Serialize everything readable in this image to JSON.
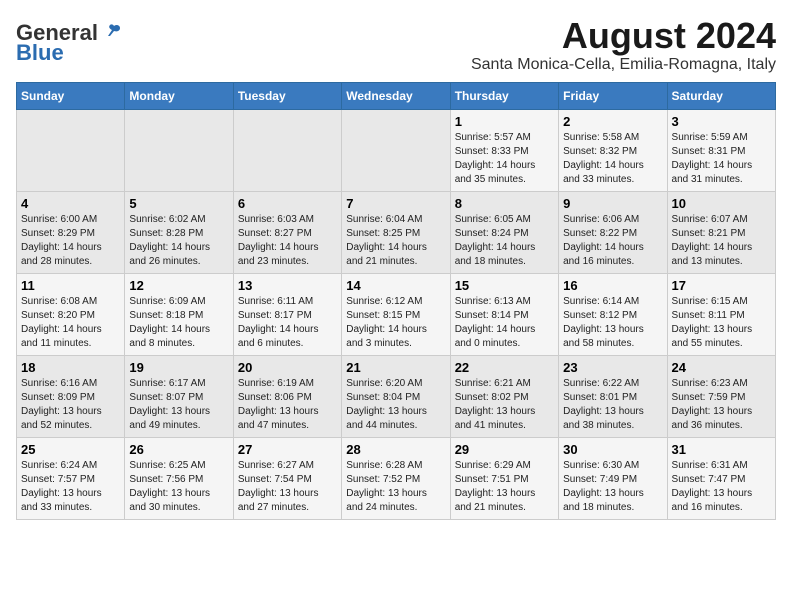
{
  "header": {
    "logo_general": "General",
    "logo_blue": "Blue",
    "title": "August 2024",
    "subtitle": "Santa Monica-Cella, Emilia-Romagna, Italy"
  },
  "days_of_week": [
    "Sunday",
    "Monday",
    "Tuesday",
    "Wednesday",
    "Thursday",
    "Friday",
    "Saturday"
  ],
  "weeks": [
    [
      {
        "num": "",
        "info": ""
      },
      {
        "num": "",
        "info": ""
      },
      {
        "num": "",
        "info": ""
      },
      {
        "num": "",
        "info": ""
      },
      {
        "num": "1",
        "info": "Sunrise: 5:57 AM\nSunset: 8:33 PM\nDaylight: 14 hours\nand 35 minutes."
      },
      {
        "num": "2",
        "info": "Sunrise: 5:58 AM\nSunset: 8:32 PM\nDaylight: 14 hours\nand 33 minutes."
      },
      {
        "num": "3",
        "info": "Sunrise: 5:59 AM\nSunset: 8:31 PM\nDaylight: 14 hours\nand 31 minutes."
      }
    ],
    [
      {
        "num": "4",
        "info": "Sunrise: 6:00 AM\nSunset: 8:29 PM\nDaylight: 14 hours\nand 28 minutes."
      },
      {
        "num": "5",
        "info": "Sunrise: 6:02 AM\nSunset: 8:28 PM\nDaylight: 14 hours\nand 26 minutes."
      },
      {
        "num": "6",
        "info": "Sunrise: 6:03 AM\nSunset: 8:27 PM\nDaylight: 14 hours\nand 23 minutes."
      },
      {
        "num": "7",
        "info": "Sunrise: 6:04 AM\nSunset: 8:25 PM\nDaylight: 14 hours\nand 21 minutes."
      },
      {
        "num": "8",
        "info": "Sunrise: 6:05 AM\nSunset: 8:24 PM\nDaylight: 14 hours\nand 18 minutes."
      },
      {
        "num": "9",
        "info": "Sunrise: 6:06 AM\nSunset: 8:22 PM\nDaylight: 14 hours\nand 16 minutes."
      },
      {
        "num": "10",
        "info": "Sunrise: 6:07 AM\nSunset: 8:21 PM\nDaylight: 14 hours\nand 13 minutes."
      }
    ],
    [
      {
        "num": "11",
        "info": "Sunrise: 6:08 AM\nSunset: 8:20 PM\nDaylight: 14 hours\nand 11 minutes."
      },
      {
        "num": "12",
        "info": "Sunrise: 6:09 AM\nSunset: 8:18 PM\nDaylight: 14 hours\nand 8 minutes."
      },
      {
        "num": "13",
        "info": "Sunrise: 6:11 AM\nSunset: 8:17 PM\nDaylight: 14 hours\nand 6 minutes."
      },
      {
        "num": "14",
        "info": "Sunrise: 6:12 AM\nSunset: 8:15 PM\nDaylight: 14 hours\nand 3 minutes."
      },
      {
        "num": "15",
        "info": "Sunrise: 6:13 AM\nSunset: 8:14 PM\nDaylight: 14 hours\nand 0 minutes."
      },
      {
        "num": "16",
        "info": "Sunrise: 6:14 AM\nSunset: 8:12 PM\nDaylight: 13 hours\nand 58 minutes."
      },
      {
        "num": "17",
        "info": "Sunrise: 6:15 AM\nSunset: 8:11 PM\nDaylight: 13 hours\nand 55 minutes."
      }
    ],
    [
      {
        "num": "18",
        "info": "Sunrise: 6:16 AM\nSunset: 8:09 PM\nDaylight: 13 hours\nand 52 minutes."
      },
      {
        "num": "19",
        "info": "Sunrise: 6:17 AM\nSunset: 8:07 PM\nDaylight: 13 hours\nand 49 minutes."
      },
      {
        "num": "20",
        "info": "Sunrise: 6:19 AM\nSunset: 8:06 PM\nDaylight: 13 hours\nand 47 minutes."
      },
      {
        "num": "21",
        "info": "Sunrise: 6:20 AM\nSunset: 8:04 PM\nDaylight: 13 hours\nand 44 minutes."
      },
      {
        "num": "22",
        "info": "Sunrise: 6:21 AM\nSunset: 8:02 PM\nDaylight: 13 hours\nand 41 minutes."
      },
      {
        "num": "23",
        "info": "Sunrise: 6:22 AM\nSunset: 8:01 PM\nDaylight: 13 hours\nand 38 minutes."
      },
      {
        "num": "24",
        "info": "Sunrise: 6:23 AM\nSunset: 7:59 PM\nDaylight: 13 hours\nand 36 minutes."
      }
    ],
    [
      {
        "num": "25",
        "info": "Sunrise: 6:24 AM\nSunset: 7:57 PM\nDaylight: 13 hours\nand 33 minutes."
      },
      {
        "num": "26",
        "info": "Sunrise: 6:25 AM\nSunset: 7:56 PM\nDaylight: 13 hours\nand 30 minutes."
      },
      {
        "num": "27",
        "info": "Sunrise: 6:27 AM\nSunset: 7:54 PM\nDaylight: 13 hours\nand 27 minutes."
      },
      {
        "num": "28",
        "info": "Sunrise: 6:28 AM\nSunset: 7:52 PM\nDaylight: 13 hours\nand 24 minutes."
      },
      {
        "num": "29",
        "info": "Sunrise: 6:29 AM\nSunset: 7:51 PM\nDaylight: 13 hours\nand 21 minutes."
      },
      {
        "num": "30",
        "info": "Sunrise: 6:30 AM\nSunset: 7:49 PM\nDaylight: 13 hours\nand 18 minutes."
      },
      {
        "num": "31",
        "info": "Sunrise: 6:31 AM\nSunset: 7:47 PM\nDaylight: 13 hours\nand 16 minutes."
      }
    ]
  ]
}
